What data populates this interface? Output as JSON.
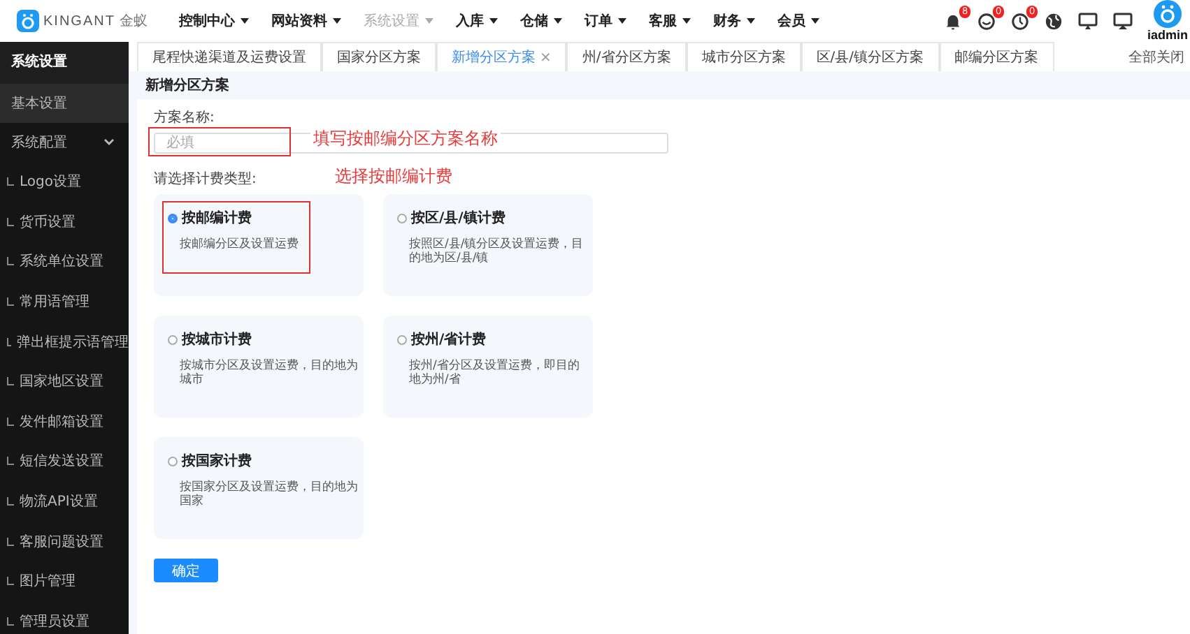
{
  "logo": {
    "brand": "KINGANT",
    "brand_cn": "金蚁"
  },
  "nav": [
    {
      "label": "控制中心",
      "selected": false
    },
    {
      "label": "网站资料",
      "selected": false
    },
    {
      "label": "系统设置",
      "selected": true
    },
    {
      "label": "入库",
      "selected": false
    },
    {
      "label": "仓储",
      "selected": false
    },
    {
      "label": "订单",
      "selected": false
    },
    {
      "label": "客服",
      "selected": false
    },
    {
      "label": "财务",
      "selected": false
    },
    {
      "label": "会员",
      "selected": false
    }
  ],
  "header_icons": [
    {
      "kind": "bell",
      "badge": "8"
    },
    {
      "kind": "chat",
      "badge": "0"
    },
    {
      "kind": "clock",
      "badge": "0"
    },
    {
      "kind": "globe"
    },
    {
      "kind": "monitor"
    },
    {
      "kind": "screen"
    }
  ],
  "user": {
    "name": "iadmin"
  },
  "sidebar": {
    "title": "系统设置",
    "items": [
      {
        "label": "基本设置",
        "selected": true,
        "expanded": false
      },
      {
        "label": "系统配置",
        "selected": false,
        "expanded": true,
        "children": [
          "Logo设置",
          "货币设置",
          "系统单位设置",
          "常用语管理",
          "弹出框提示语管理",
          "国家地区设置",
          "发件邮箱设置",
          "短信发送设置",
          "物流API设置",
          "客服问题设置",
          "图片管理",
          "管理员设置"
        ]
      }
    ]
  },
  "tabs": [
    {
      "label": "尾程快递渠道及运费设置",
      "selected": false
    },
    {
      "label": "国家分区方案",
      "selected": false
    },
    {
      "label": "新增分区方案",
      "selected": true,
      "close": "×"
    },
    {
      "label": "州/省分区方案",
      "selected": false
    },
    {
      "label": "城市分区方案",
      "selected": false
    },
    {
      "label": "区/县/镇分区方案",
      "selected": false
    },
    {
      "label": "邮编分区方案",
      "selected": false
    }
  ],
  "close_all": "全部关闭",
  "form": {
    "title": "新增分区方案",
    "name_label": "方案名称:",
    "name_placeholder": "必填",
    "type_label": "请选择计费类型:",
    "options": [
      {
        "title": "按邮编计费",
        "desc": "按邮编分区及设置运费",
        "selected": true
      },
      {
        "title": "按区/县/镇计费",
        "desc": "按照区/县/镇分区及设置运费，目的地为区/县/镇",
        "selected": false
      },
      {
        "title": "按城市计费",
        "desc": "按城市分区及设置运费，目的地为城市",
        "selected": false
      },
      {
        "title": "按州/省计费",
        "desc": "按州/省分区及设置运费，即目的地为州/省",
        "selected": false
      },
      {
        "title": "按国家计费",
        "desc": "按国家分区及设置运费，目的地为国家",
        "selected": false
      }
    ],
    "submit": "确定"
  },
  "annotations": {
    "name_note": "填写按邮编分区方案名称",
    "type_note": "选择按邮编计费"
  }
}
